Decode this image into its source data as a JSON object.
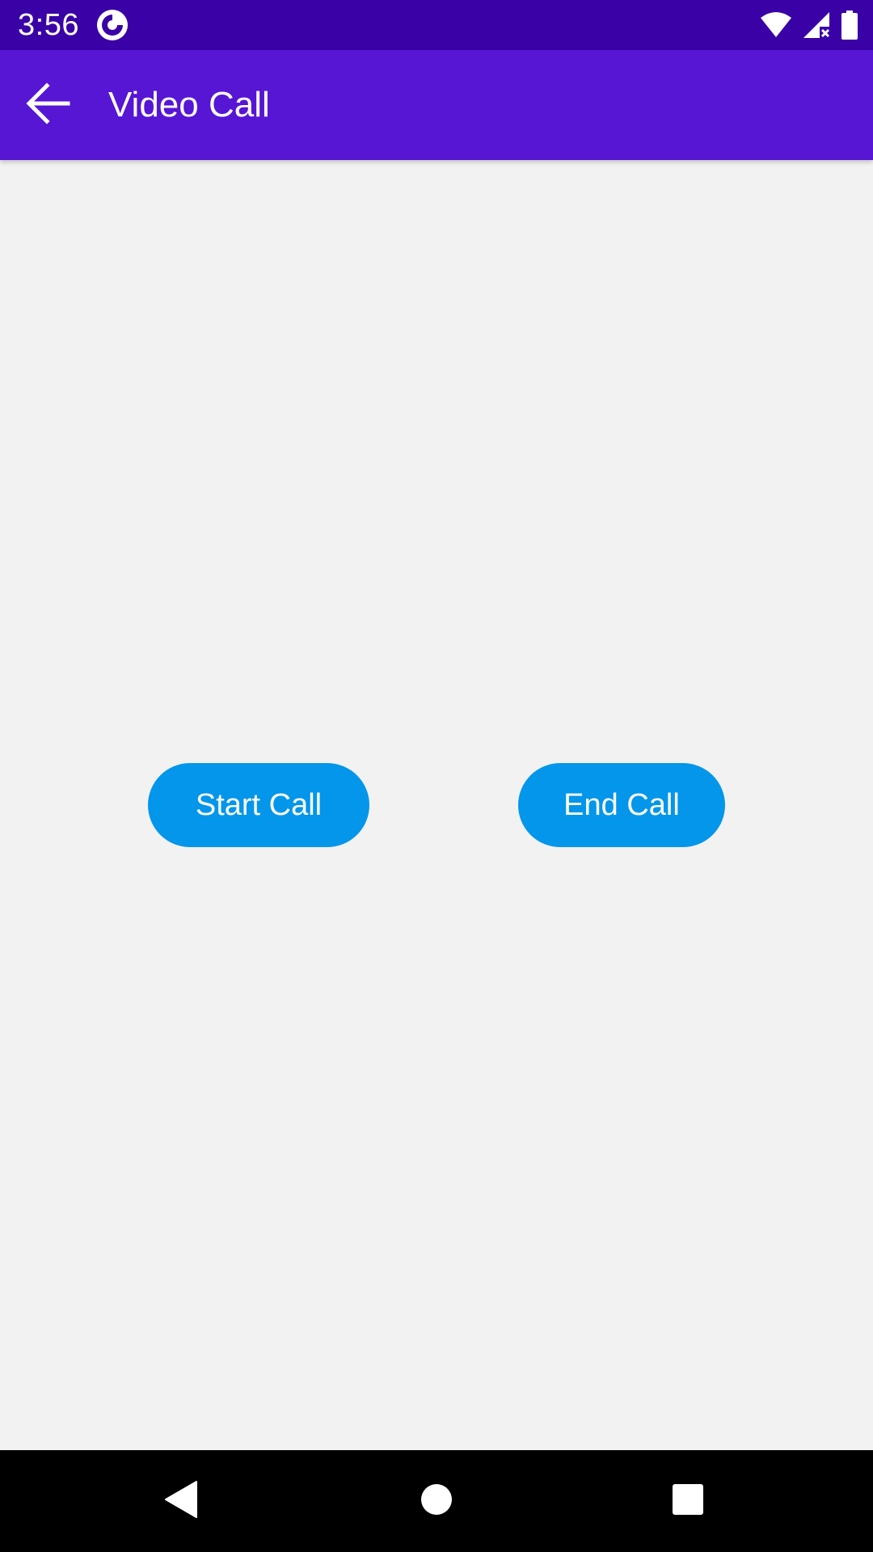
{
  "status_bar": {
    "time": "3:56",
    "icons": [
      "app-notification-icon",
      "wifi-icon",
      "cellular-no-signal-icon",
      "battery-icon"
    ]
  },
  "app_bar": {
    "title": "Video Call",
    "back_icon": "arrow-back-icon"
  },
  "main": {
    "start_call_label": "Start Call",
    "end_call_label": "End Call"
  },
  "nav_bar": {
    "icons": [
      "back-triangle-icon",
      "home-circle-icon",
      "recents-square-icon"
    ]
  },
  "colors": {
    "status_bar": "#3a02a6",
    "app_bar": "#5715d4",
    "background": "#f2f2f3",
    "button": "#0396ea",
    "nav_bar": "#000000"
  }
}
